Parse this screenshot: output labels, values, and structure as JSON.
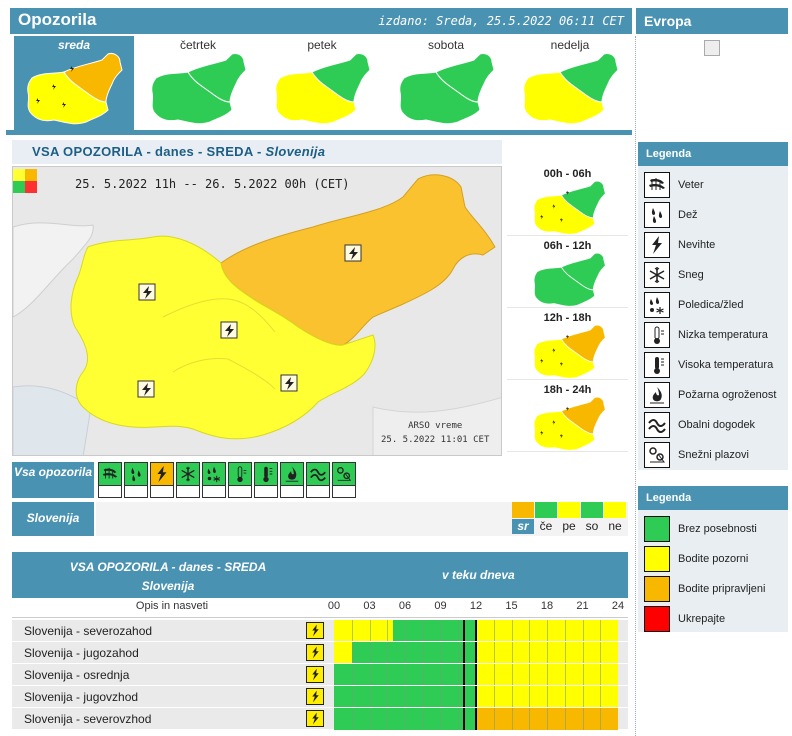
{
  "header": {
    "title": "Opozorila",
    "issued": "izdano: Sreda, 25.5.2022 06:11 CET",
    "europe": "Evropa"
  },
  "days": [
    {
      "label": "sreda",
      "active": true,
      "west": "#ffff00",
      "east": "#f9b800"
    },
    {
      "label": "četrtek",
      "active": false,
      "west": "#2ecc55",
      "east": "#2ecc55"
    },
    {
      "label": "petek",
      "active": false,
      "west": "#ffff00",
      "east": "#2ecc55"
    },
    {
      "label": "sobota",
      "active": false,
      "west": "#2ecc55",
      "east": "#2ecc55"
    },
    {
      "label": "nedelja",
      "active": false,
      "west": "#ffff00",
      "east": "#2ecc55"
    }
  ],
  "main": {
    "title_prefix": "VSA OPOZORILA   -   danes   -   SREDA   -",
    "title_region": "Slovenija",
    "map_date": "25. 5.2022  11h  --  26. 5.2022  00h     (CET)",
    "credit_line1": "ARSO vreme",
    "credit_line2": "25. 5.2022  11:01 CET"
  },
  "slots": [
    {
      "label": "00h - 06h",
      "west": "#ffff00",
      "east": "#2ecc55"
    },
    {
      "label": "06h - 12h",
      "west": "#2ecc55",
      "east": "#2ecc55"
    },
    {
      "label": "12h - 18h",
      "west": "#ffff00",
      "east": "#f9b800"
    },
    {
      "label": "18h - 24h",
      "west": "#ffff00",
      "east": "#f9b800"
    }
  ],
  "filter": {
    "vsa_label": "Vsa opozorila",
    "region_label": "Slovenija",
    "icons": [
      "wind-icon",
      "rain-icon",
      "thunderstorm-icon",
      "snow-icon",
      "ice-icon",
      "low-temperature-icon",
      "high-temperature-icon",
      "fire-icon",
      "coastal-icon",
      "avalanche-icon"
    ],
    "active_icon_index": 2,
    "mini_days": [
      {
        "label": "sr",
        "color": "#f9b800",
        "active": true
      },
      {
        "label": "če",
        "color": "#2ecc55",
        "active": false
      },
      {
        "label": "pe",
        "color": "#ffff00",
        "active": false
      },
      {
        "label": "so",
        "color": "#2ecc55",
        "active": false
      },
      {
        "label": "ne",
        "color": "#ffff00",
        "active": false
      }
    ]
  },
  "legend": {
    "title": "Legenda",
    "items": [
      {
        "label": "Veter",
        "icon": "wind-icon"
      },
      {
        "label": "Dež",
        "icon": "rain-icon"
      },
      {
        "label": "Nevihte",
        "icon": "thunderstorm-icon"
      },
      {
        "label": "Sneg",
        "icon": "snow-icon"
      },
      {
        "label": "Poledica/žled",
        "icon": "ice-icon"
      },
      {
        "label": "Nizka temperatura",
        "icon": "low-temperature-icon"
      },
      {
        "label": "Visoka temperatura",
        "icon": "high-temperature-icon"
      },
      {
        "label": "Požarna ogroženost",
        "icon": "fire-icon"
      },
      {
        "label": "Obalni dogodek",
        "icon": "coastal-icon"
      },
      {
        "label": "Snežni plazovi",
        "icon": "avalanche-icon"
      }
    ]
  },
  "color_legend": {
    "title": "Legenda",
    "items": [
      {
        "label": "Brez posebnosti",
        "color": "#2ecc55"
      },
      {
        "label": "Bodite pozorni",
        "color": "#ffff00"
      },
      {
        "label": "Bodite pripravljeni",
        "color": "#f9b800"
      },
      {
        "label": "Ukrepajte",
        "color": "#ff0000"
      }
    ]
  },
  "table": {
    "title_line1": "VSA OPOZORILA - danes - SREDA",
    "title_line2": "Slovenija",
    "during_day": "v teku dneva",
    "desc_header": "Opis in nasveti",
    "hours": [
      "00",
      "03",
      "06",
      "09",
      "12",
      "15",
      "18",
      "21",
      "24"
    ],
    "now_hours": [
      11,
      12
    ],
    "rows": [
      {
        "name": "Slovenija - severozahod",
        "segments": [
          {
            "from": 0,
            "to": 5,
            "color": "#ffff00"
          },
          {
            "from": 5,
            "to": 12,
            "color": "#2ecc55"
          },
          {
            "from": 12,
            "to": 24,
            "color": "#ffff00"
          }
        ]
      },
      {
        "name": "Slovenija - jugozahod",
        "segments": [
          {
            "from": 0,
            "to": 1.5,
            "color": "#ffff00"
          },
          {
            "from": 1.5,
            "to": 12,
            "color": "#2ecc55"
          },
          {
            "from": 12,
            "to": 24,
            "color": "#ffff00"
          }
        ]
      },
      {
        "name": "Slovenija - osrednja",
        "segments": [
          {
            "from": 0,
            "to": 12,
            "color": "#2ecc55"
          },
          {
            "from": 12,
            "to": 24,
            "color": "#ffff00"
          }
        ]
      },
      {
        "name": "Slovenija - jugovzhod",
        "segments": [
          {
            "from": 0,
            "to": 12,
            "color": "#2ecc55"
          },
          {
            "from": 12,
            "to": 24,
            "color": "#ffff00"
          }
        ]
      },
      {
        "name": "Slovenija - severovzhod",
        "segments": [
          {
            "from": 0,
            "to": 12,
            "color": "#2ecc55"
          },
          {
            "from": 12,
            "to": 24,
            "color": "#f9b800"
          }
        ]
      }
    ]
  }
}
